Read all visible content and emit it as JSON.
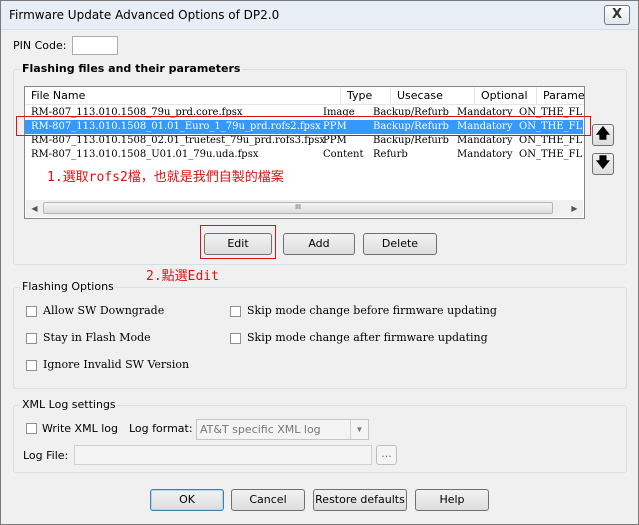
{
  "window": {
    "title": "Firmware Update Advanced Options of DP2.0",
    "close_glyph": "X"
  },
  "pin": {
    "label": "PIN Code:",
    "value": ""
  },
  "flashing_files": {
    "group_title": "Flashing files and their parameters",
    "columns": [
      "File Name",
      "Type",
      "Usecase",
      "Optional",
      "Parameters"
    ],
    "rows": [
      [
        "RM-807_113.010.1508_79u_prd.core.fpsx",
        "Image",
        "Backup/Refurb",
        "Mandatory",
        "ON_THE_FL"
      ],
      [
        "RM-807_113.010.1508_01.01_Euro_1_79u_prd.rofs2.fpsx",
        "PPM",
        "Backup/Refurb",
        "Mandatory",
        "ON_THE_FL"
      ],
      [
        "RM-807_113.010.1508_02.01_truetest_79u_prd.rofs3.fpsx",
        "PPM",
        "Backup/Refurb",
        "Mandatory",
        "ON_THE_FL"
      ],
      [
        "RM-807_113.010.1508_U01.01_79u.uda.fpsx",
        "Content",
        "Refurb",
        "Mandatory",
        "ON_THE_FL"
      ]
    ],
    "selected_row": 1,
    "scroll_grip": "III",
    "scroll_left": "◀",
    "scroll_right": "▶",
    "move_up": "🡅",
    "move_down": "🡇",
    "buttons": {
      "edit": "Edit",
      "add": "Add",
      "delete": "Delete"
    }
  },
  "annotations": {
    "step1": "1.選取rofs2檔，也就是我們自製的檔案",
    "step2": "2.點選Edit"
  },
  "flashing_options": {
    "group_title": "Flashing Options",
    "options": [
      {
        "label": "Allow SW Downgrade",
        "checked": false
      },
      {
        "label": "Stay in Flash Mode",
        "checked": false
      },
      {
        "label": "Ignore Invalid SW Version",
        "checked": false
      },
      {
        "label": "Skip mode change before firmware updating",
        "checked": false
      },
      {
        "label": "Skip mode change after firmware updating",
        "checked": false
      }
    ]
  },
  "xml_log": {
    "group_title": "XML Log settings",
    "write_label": "Write XML log",
    "write_checked": false,
    "format_label": "Log format:",
    "format_value": "AT&T specific XML log",
    "file_label": "Log File:",
    "file_value": "",
    "browse_label": "..."
  },
  "footer": {
    "ok": "OK",
    "cancel": "Cancel",
    "restore": "Restore defaults",
    "help": "Help"
  },
  "colors": {
    "selection": "#3399ff",
    "annotation": "#dd1111"
  }
}
